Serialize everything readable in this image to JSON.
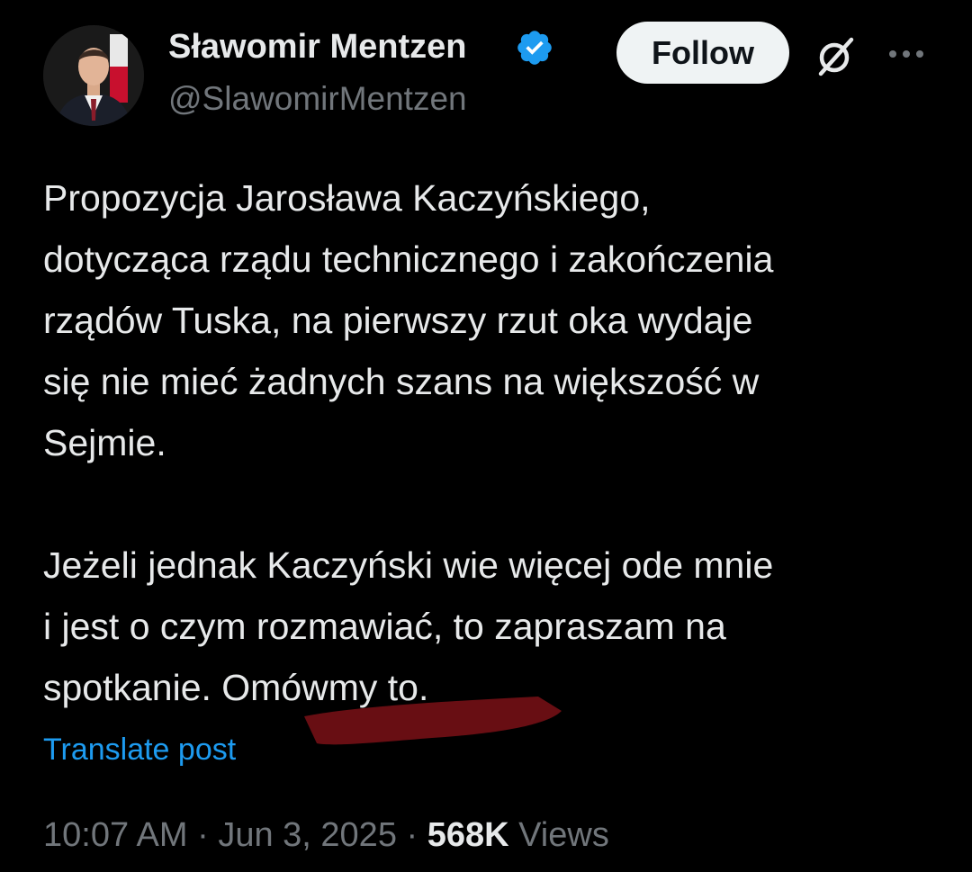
{
  "author": {
    "display_name": "Sławomir Mentzen",
    "handle": "@SlawomirMentzen",
    "verified": true,
    "verified_icon": "verified-badge-icon",
    "verified_color": "#1d9bf0"
  },
  "actions": {
    "follow_label": "Follow",
    "grok_icon": "grok-icon",
    "more_icon": "more-dots-icon"
  },
  "post": {
    "paragraph_1": "Propozycja Jarosława Kaczyńskiego,\ndotycząca rządu technicznego i zakończenia\nrządów Tuska, na pierwszy rzut oka wydaje\nsię nie mieć żadnych szans na większość w\nSejmie.",
    "paragraph_2": "Jeżeli jednak Kaczyński wie więcej ode mnie\ni jest o czym rozmawiać, to zapraszam na\nspotkanie. Omówmy to.",
    "highlight_mark_color": "#6e0f14"
  },
  "translate_label": "Translate post",
  "meta": {
    "time": "10:07 AM",
    "separator": "·",
    "date": "Jun 3, 2025",
    "views_count": "568K",
    "views_label": "Views"
  },
  "colors": {
    "background": "#000000",
    "primary_text": "#e7e9ea",
    "secondary_text": "#71767b",
    "link": "#1d9bf0"
  }
}
